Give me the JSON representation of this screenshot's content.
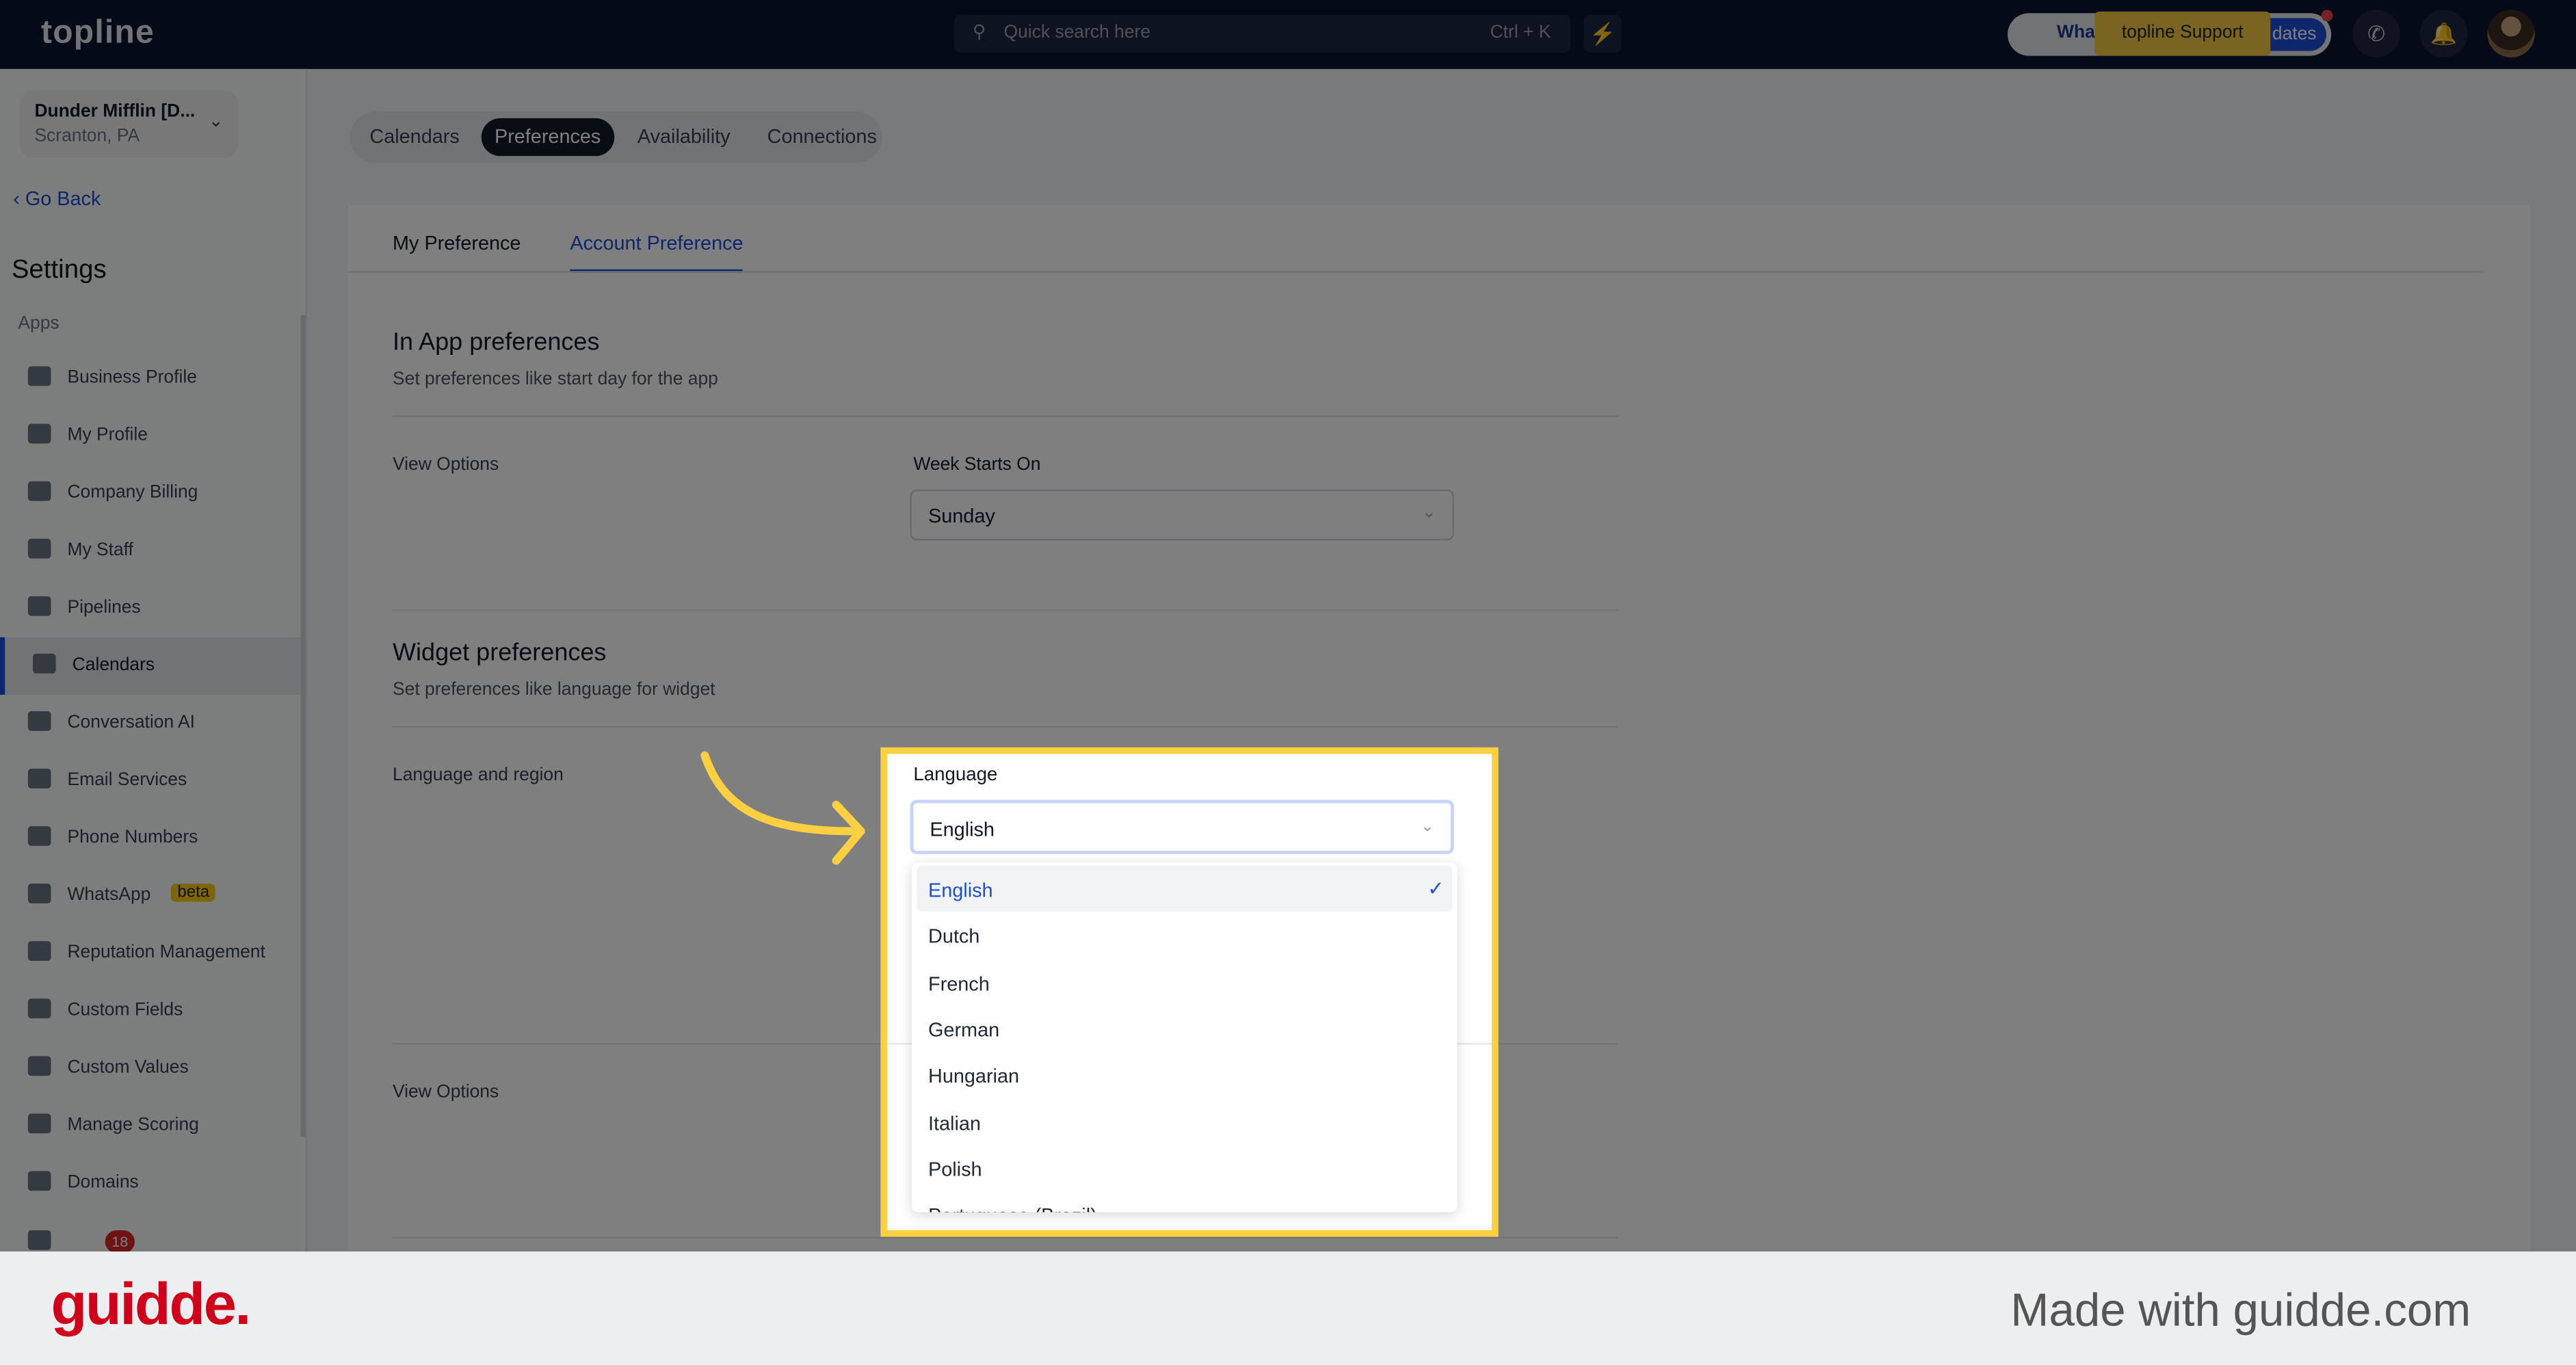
{
  "topbar": {
    "logo": "topline",
    "search_placeholder": "Quick search here",
    "search_shortcut": "Ctrl + K",
    "whats_new_label": "What",
    "updates_label": "dates",
    "support_label": "topline Support"
  },
  "account": {
    "name": "Dunder Mifflin [D...",
    "location": "Scranton, PA"
  },
  "sidebar": {
    "go_back": "Go Back",
    "title": "Settings",
    "section": "Apps",
    "items": [
      {
        "label": "Business Profile",
        "icon": "briefcase-icon"
      },
      {
        "label": "My Profile",
        "icon": "user-icon"
      },
      {
        "label": "Company Billing",
        "icon": "grid-icon"
      },
      {
        "label": "My Staff",
        "icon": "staff-icon"
      },
      {
        "label": "Pipelines",
        "icon": "filter-icon"
      },
      {
        "label": "Calendars",
        "icon": "calendar-icon",
        "active": true
      },
      {
        "label": "Conversation AI",
        "icon": "chat-icon"
      },
      {
        "label": "Email Services",
        "icon": "mail-icon"
      },
      {
        "label": "Phone Numbers",
        "icon": "phone-icon"
      },
      {
        "label": "WhatsApp",
        "icon": "whatsapp-icon",
        "badge": "beta"
      },
      {
        "label": "Reputation Management",
        "icon": "star-icon"
      },
      {
        "label": "Custom Fields",
        "icon": "edit-field-icon"
      },
      {
        "label": "Custom Values",
        "icon": "pie-icon"
      },
      {
        "label": "Manage Scoring",
        "icon": "chart-icon"
      },
      {
        "label": "Domains",
        "icon": "browser-icon"
      }
    ],
    "chat_badge_count": "18"
  },
  "tabs": [
    "Calendars",
    "Preferences",
    "Availability",
    "Connections"
  ],
  "active_tab": "Preferences",
  "subtabs": [
    "My Preference",
    "Account Preference"
  ],
  "active_subtab": "Account Preference",
  "in_app": {
    "title": "In App preferences",
    "subtitle": "Set preferences like start day for the app",
    "row_label": "View Options",
    "field_label": "Week Starts On",
    "value": "Sunday"
  },
  "widget": {
    "title": "Widget preferences",
    "subtitle": "Set preferences like language for widget",
    "row_label": "Language and region",
    "field_label": "Language",
    "value": "English",
    "view_options": "View Options"
  },
  "language_options": [
    "English",
    "Dutch",
    "French",
    "German",
    "Hungarian",
    "Italian",
    "Polish",
    "Portuguese (Brazil)"
  ],
  "selected_language": "English",
  "highlight_color": "#fdd042",
  "footer": {
    "brand": "guidde.",
    "made_with": "Made with guidde.com"
  }
}
